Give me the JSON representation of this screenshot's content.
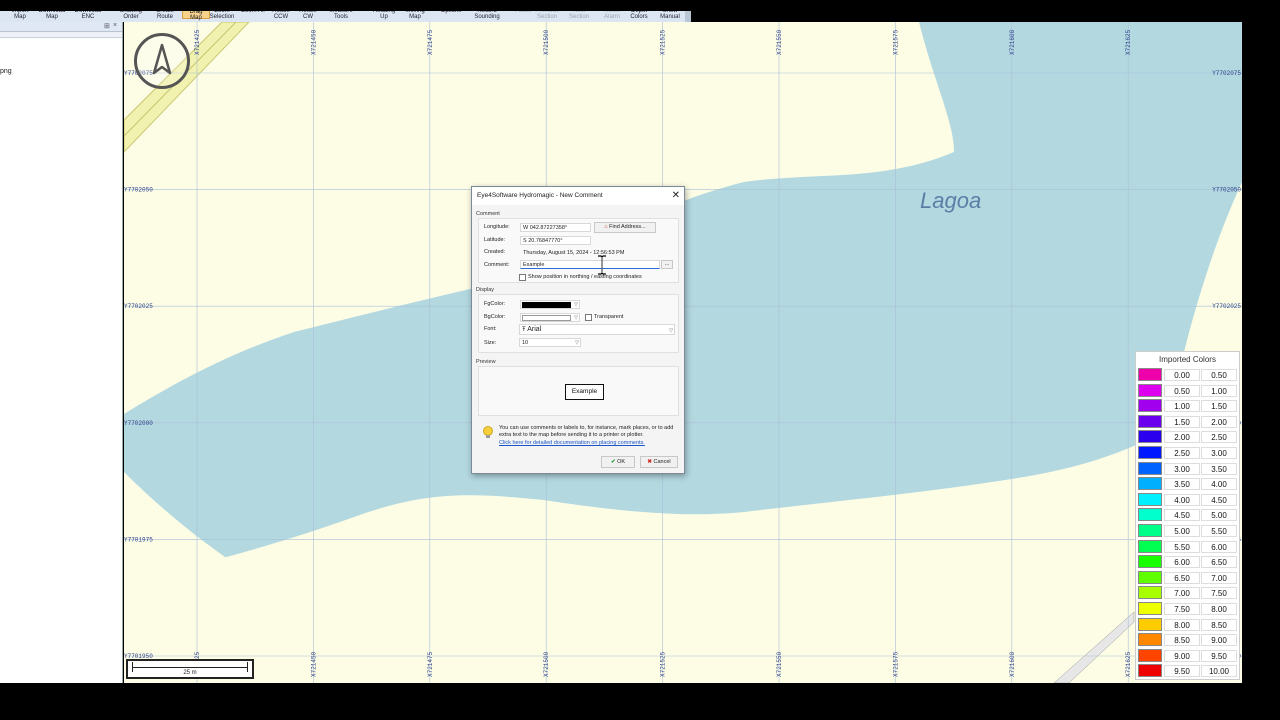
{
  "ribbon": {
    "items": [
      {
        "label": "Import Map",
        "state": "normal"
      },
      {
        "label": "Download Map",
        "state": "normal"
      },
      {
        "label": "Download ENC",
        "state": "normal"
      },
      {
        "label": "Drawing Order",
        "state": "normal"
      },
      {
        "label": "Create Route",
        "state": "normal"
      },
      {
        "label": "Drag Map",
        "state": "active"
      },
      {
        "label": "Zoom Selection",
        "state": "normal"
      },
      {
        "label": "Zoom All",
        "state": "normal"
      },
      {
        "label": "Rotate CCW",
        "state": "normal"
      },
      {
        "label": "Rotate CW",
        "state": "normal"
      },
      {
        "label": "Measure Tools",
        "state": "normal"
      },
      {
        "label": "Heading Up",
        "state": "normal"
      },
      {
        "label": "Moving Map",
        "state": "normal"
      },
      {
        "label": "Options",
        "state": "normal"
      },
      {
        "label": "Record Sounding",
        "state": "normal"
      },
      {
        "label": "Pause",
        "state": "disabled"
      },
      {
        "label": "Previous Section",
        "state": "disabled"
      },
      {
        "label": "Next Section",
        "state": "disabled"
      },
      {
        "label": "Reset Alarm",
        "state": "disabled"
      },
      {
        "label": "Depth Colors",
        "state": "normal"
      },
      {
        "label": "Show Manual",
        "state": "normal"
      }
    ]
  },
  "left_panel": {
    "pin_glyph": "×",
    "file_label": "png"
  },
  "map": {
    "label": "Lagoa",
    "x_labels": [
      "X721425",
      "X721450",
      "X721475",
      "X721500",
      "X721525",
      "X721550",
      "X721575",
      "X721600",
      "X721625"
    ],
    "y_labels": [
      "Y7702075",
      "Y7702050",
      "Y7702025",
      "Y7702000",
      "Y7701975",
      "Y7701950"
    ],
    "scale_label": "25 m",
    "colors": {
      "land": "#fdfde6",
      "water": "#b3d8e0",
      "grid": "#a9bfd8",
      "coord_text": "#2b3f8a"
    }
  },
  "legend": {
    "title": "Imported Colors",
    "rows": [
      {
        "from": "0.00",
        "to": "0.50",
        "color": "#ee00aa"
      },
      {
        "from": "0.50",
        "to": "1.00",
        "color": "#dd00ee"
      },
      {
        "from": "1.00",
        "to": "1.50",
        "color": "#a000ee"
      },
      {
        "from": "1.50",
        "to": "2.00",
        "color": "#6a00ee"
      },
      {
        "from": "2.00",
        "to": "2.50",
        "color": "#2a00ee"
      },
      {
        "from": "2.50",
        "to": "3.00",
        "color": "#0018ff"
      },
      {
        "from": "3.00",
        "to": "3.50",
        "color": "#0062ff"
      },
      {
        "from": "3.50",
        "to": "4.00",
        "color": "#00b0ff"
      },
      {
        "from": "4.00",
        "to": "4.50",
        "color": "#00f0ff"
      },
      {
        "from": "4.50",
        "to": "5.00",
        "color": "#00ffcc"
      },
      {
        "from": "5.00",
        "to": "5.50",
        "color": "#00ff88"
      },
      {
        "from": "5.50",
        "to": "6.00",
        "color": "#00ff50"
      },
      {
        "from": "6.00",
        "to": "6.50",
        "color": "#18ff00"
      },
      {
        "from": "6.50",
        "to": "7.00",
        "color": "#60ff00"
      },
      {
        "from": "7.00",
        "to": "7.50",
        "color": "#a8ff00"
      },
      {
        "from": "7.50",
        "to": "8.00",
        "color": "#eeff00"
      },
      {
        "from": "8.00",
        "to": "8.50",
        "color": "#ffcc00"
      },
      {
        "from": "8.50",
        "to": "9.00",
        "color": "#ff8800"
      },
      {
        "from": "9.00",
        "to": "9.50",
        "color": "#ff4400"
      },
      {
        "from": "9.50",
        "to": "10.00",
        "color": "#ee0000"
      }
    ]
  },
  "dialog": {
    "title": "Eye4Software Hydromagic - New Comment",
    "close_glyph": "✕",
    "comment_group": "Comment",
    "longitude_label": "Longitude:",
    "longitude_value": "W 042.87227358°",
    "find_address_label": "Find Address...",
    "latitude_label": "Latitude:",
    "latitude_value": "S 20.76847770°",
    "created_label": "Created:",
    "created_value": "Thursday, August 15, 2024 - 12:56:53 PM",
    "comment_label": "Comment:",
    "comment_value": "Example",
    "comment_browse": "...",
    "show_position_label": "Show position in northing / easting coordinates",
    "display_group": "Display",
    "fgcolor_label": "FgColor:",
    "bgcolor_label": "BgColor:",
    "transparent_label": "Transparent",
    "font_label": "Font:",
    "font_value": "Arial",
    "size_label": "Size:",
    "size_value": "10",
    "preview_group": "Preview",
    "preview_text": "Example",
    "tip_text": "You can use comments or labels to, for instance, mark places, or to add extra text to the map before sending it to a printer or plotter.",
    "tip_link": "Click here for detailed documentation on placing comments.",
    "ok_label": "OK",
    "cancel_label": "Cancel",
    "fg_color": "#000000",
    "bg_color": "#ffffff"
  }
}
